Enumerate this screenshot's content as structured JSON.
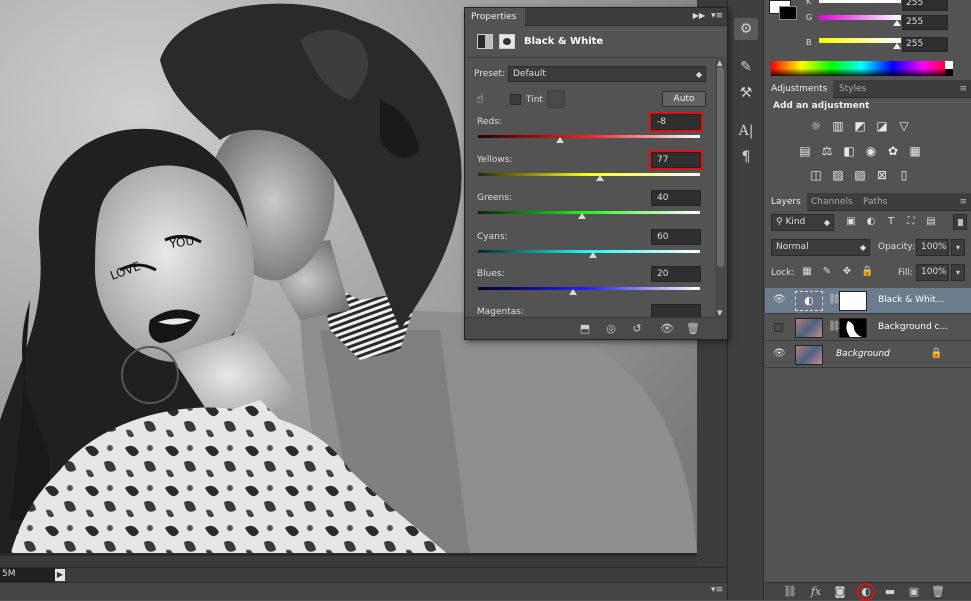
{
  "canvas": {
    "zoom_text": "5M",
    "photo_caption_words": [
      "LOVE",
      "YOU"
    ]
  },
  "color_panel": {
    "channels": [
      {
        "label": "K",
        "value": "255",
        "gradient": "#ffffff"
      },
      {
        "label": "G",
        "value": "255",
        "gradient": "linear-gradient(to right,#e000e0,#ffffff)"
      },
      {
        "label": "B",
        "value": "255",
        "gradient": "linear-gradient(to right,#ffff00,#ffffff)"
      }
    ]
  },
  "adjustments_panel": {
    "tabs": [
      "Adjustments",
      "Styles"
    ],
    "heading": "Add an adjustment"
  },
  "layers_panel": {
    "tabs": [
      "Layers",
      "Channels",
      "Paths"
    ],
    "filter_kind": "Kind",
    "blend_mode": "Normal",
    "opacity_label": "Opacity:",
    "opacity_value": "100%",
    "lock_label": "Lock:",
    "fill_label": "Fill:",
    "fill_value": "100%",
    "layers": [
      {
        "name": "Black & Whit...",
        "visible": true,
        "selected": true
      },
      {
        "name": "Background c...",
        "visible": false,
        "selected": false
      },
      {
        "name": "Background",
        "visible": true,
        "selected": false,
        "locked": true
      }
    ]
  },
  "properties_panel": {
    "tab": "Properties",
    "adjustment_title": "Black & White",
    "preset_label": "Preset:",
    "preset_value": "Default",
    "tint_label": "Tint",
    "auto_label": "Auto",
    "sliders": [
      {
        "label": "Reds:",
        "value": "-8",
        "fraction": 0.37,
        "gradient": "linear-gradient(to right,#2a0000,#ff2020,#ffffff)",
        "highlighted": true
      },
      {
        "label": "Yellows:",
        "value": "77",
        "fraction": 0.55,
        "gradient": "linear-gradient(to right,#2a2a00,#ffff20,#ffffff)",
        "highlighted": true
      },
      {
        "label": "Greens:",
        "value": "40",
        "fraction": 0.47,
        "gradient": "linear-gradient(to right,#002a00,#20ff20,#ffffff)",
        "highlighted": false
      },
      {
        "label": "Cyans:",
        "value": "60",
        "fraction": 0.52,
        "gradient": "linear-gradient(to right,#002a2a,#20ffff,#ffffff)",
        "highlighted": false
      },
      {
        "label": "Blues:",
        "value": "20",
        "fraction": 0.43,
        "gradient": "linear-gradient(to right,#00002a,#2020ff,#ffffff)",
        "highlighted": false
      },
      {
        "label": "Magentas:",
        "value": "",
        "fraction": 0.5,
        "gradient": "linear-gradient(to right,#2a002a,#ff20ff,#ffffff)",
        "highlighted": false
      }
    ]
  }
}
